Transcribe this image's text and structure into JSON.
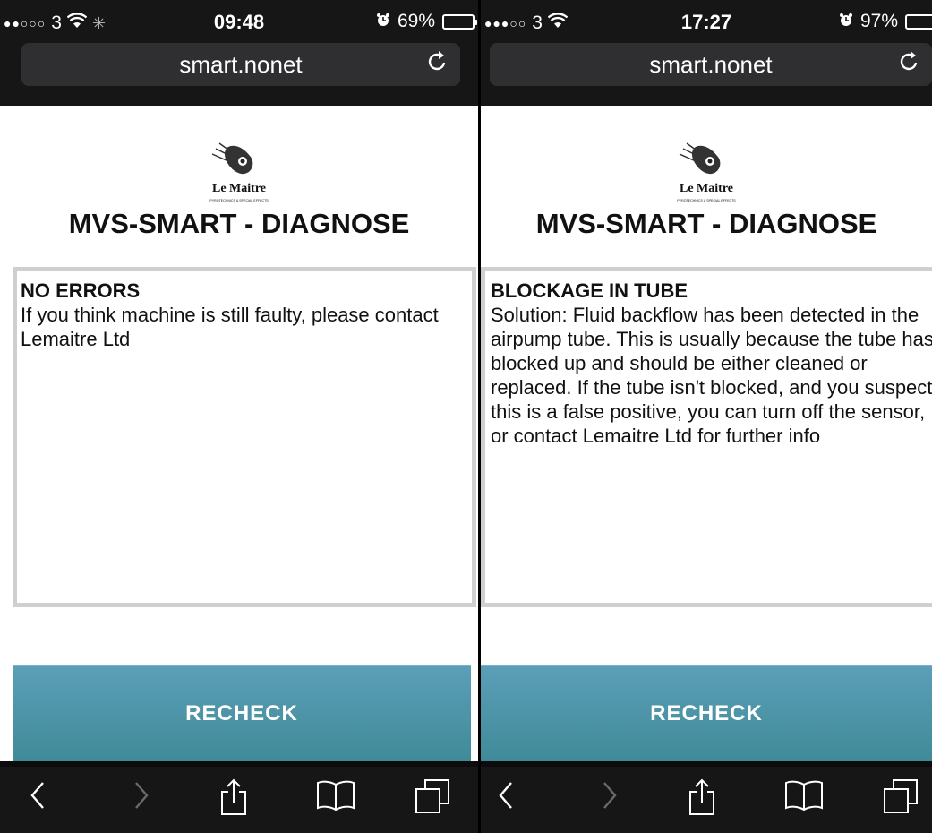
{
  "screens": [
    {
      "status": {
        "dots": "●●○○○",
        "carrier": "3",
        "wifi": "wifi",
        "loading": "✳",
        "time": "09:48",
        "alarm": "⏰",
        "battery_text": "69%",
        "battery_level": 0.69,
        "battery_color": "#ffffff"
      },
      "url": "smart.nonet",
      "reload_icon": "↻",
      "title": "MVS-SMART - DIAGNOSE",
      "heading": "NO ERRORS",
      "message": "If you think machine is still faulty, please contact Lemaitre Ltd",
      "button_label": "RECHECK"
    },
    {
      "status": {
        "dots": "●●●○○",
        "carrier": "3",
        "wifi": "wifi",
        "time": "17:27",
        "alarm": "⏰",
        "battery_text": "97%",
        "battery_level": 0.97,
        "battery_color": "#4cd964"
      },
      "url": "smart.nonet",
      "reload_icon": "↻",
      "title": "MVS-SMART - DIAGNOSE",
      "heading": "BLOCKAGE IN TUBE",
      "message": "Solution: Fluid backflow has been detected in the airpump tube. This is usually because the tube has blocked up and should be either cleaned or replaced. If the tube isn't blocked, and you suspect this is a false positive, you can turn off the sensor, or contact Lemaitre Ltd for further info",
      "button_label": "RECHECK"
    }
  ],
  "logo": {
    "brand": "Le Maitre",
    "tagline": "PYROTECHNICS & SPECIAL EFFECTS"
  },
  "toolbar": {
    "icons": [
      "back-icon",
      "forward-icon",
      "share-icon",
      "bookmarks-icon",
      "tabs-icon"
    ]
  }
}
